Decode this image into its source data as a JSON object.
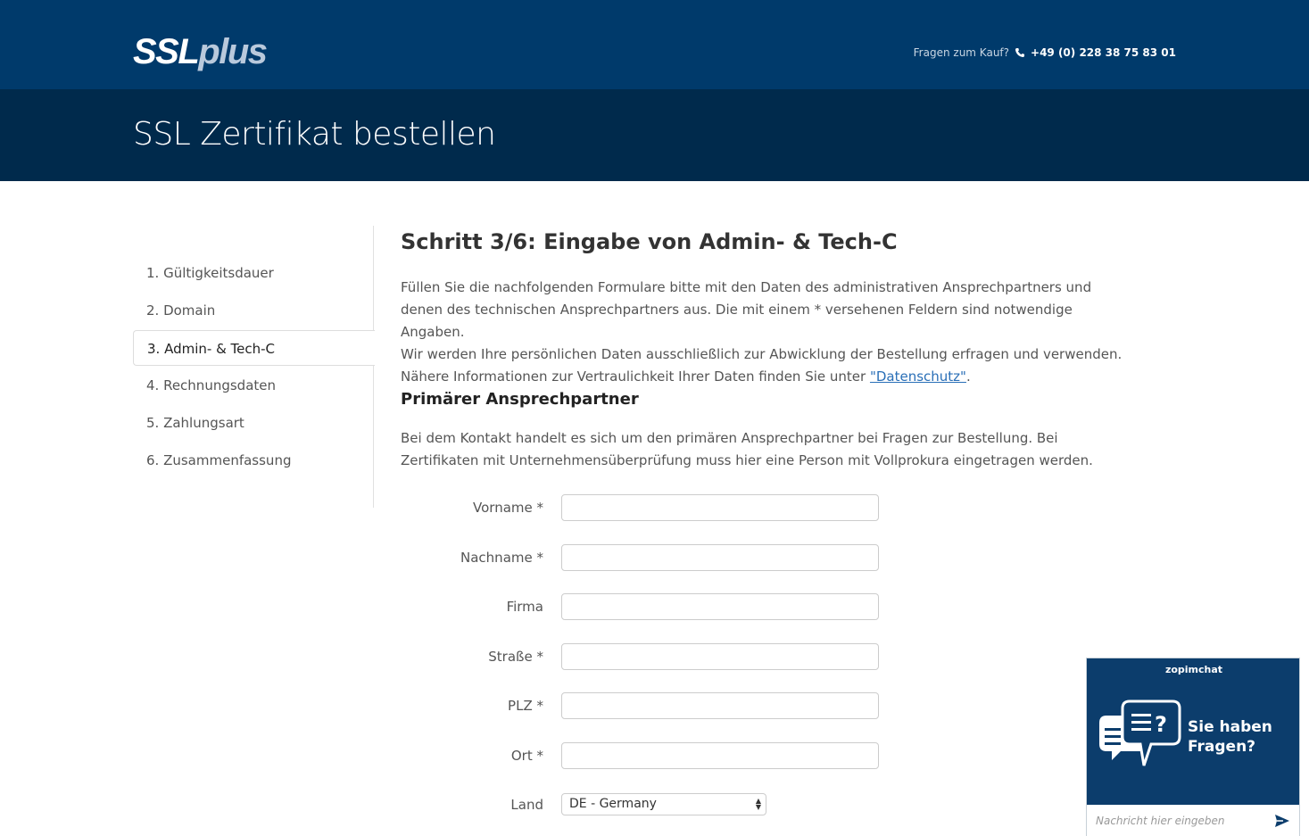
{
  "header": {
    "logo_ssl": "SSL",
    "logo_plus": "plus",
    "contact_label": "Fragen zum Kauf?",
    "phone": "+49 (0) 228 38 75 83 01",
    "page_title": "SSL Zertifikat bestellen"
  },
  "sidebar": {
    "steps": [
      {
        "label": "1. Gültigkeitsdauer"
      },
      {
        "label": "2. Domain"
      },
      {
        "label": "3. Admin- & Tech-C"
      },
      {
        "label": "4. Rechnungsdaten"
      },
      {
        "label": "5. Zahlungsart"
      },
      {
        "label": "6. Zusammenfassung"
      }
    ],
    "active_index": 2
  },
  "main": {
    "heading": "Schritt 3/6: Eingabe von Admin- & Tech-C",
    "intro_part1": "Füllen Sie die nachfolgenden Formulare bitte mit den Daten des administrativen Ansprechpartners und denen des technischen Ansprechpartners aus. Die mit einem * versehenen Feldern sind notwendige Angaben.",
    "intro_part2": "Wir werden Ihre persönlichen Daten ausschließlich zur Abwicklung der Bestellung erfragen und verwenden. Nähere Informationen zur Vertraulichkeit Ihrer Daten finden Sie unter",
    "privacy_link": "\"Datenschutz\"",
    "intro_end": ".",
    "section_heading": "Primärer Ansprechpartner",
    "section_text": "Bei dem Kontakt handelt es sich um den primären Ansprechpartner bei Fragen zur Bestellung. Bei Zertifikaten mit Unternehmensüberprüfung muss hier eine Person mit Vollprokura eingetragen werden."
  },
  "form": {
    "fields": [
      {
        "label": "Vorname *",
        "value": ""
      },
      {
        "label": "Nachname *",
        "value": ""
      },
      {
        "label": "Firma",
        "value": ""
      },
      {
        "label": "Straße *",
        "value": ""
      },
      {
        "label": "PLZ *",
        "value": ""
      },
      {
        "label": "Ort *",
        "value": ""
      }
    ],
    "country_label": "Land",
    "country_value": "DE - Germany"
  },
  "chat": {
    "brand": "zopimchat",
    "question_line1": "Sie haben",
    "question_line2": "Fragen?",
    "input_placeholder": "Nachricht hier eingeben"
  },
  "colors": {
    "header_bg": "#003a6b",
    "title_bg": "#002a4c",
    "link": "#2a6fb7",
    "chat_bg": "#0c3d6c"
  }
}
